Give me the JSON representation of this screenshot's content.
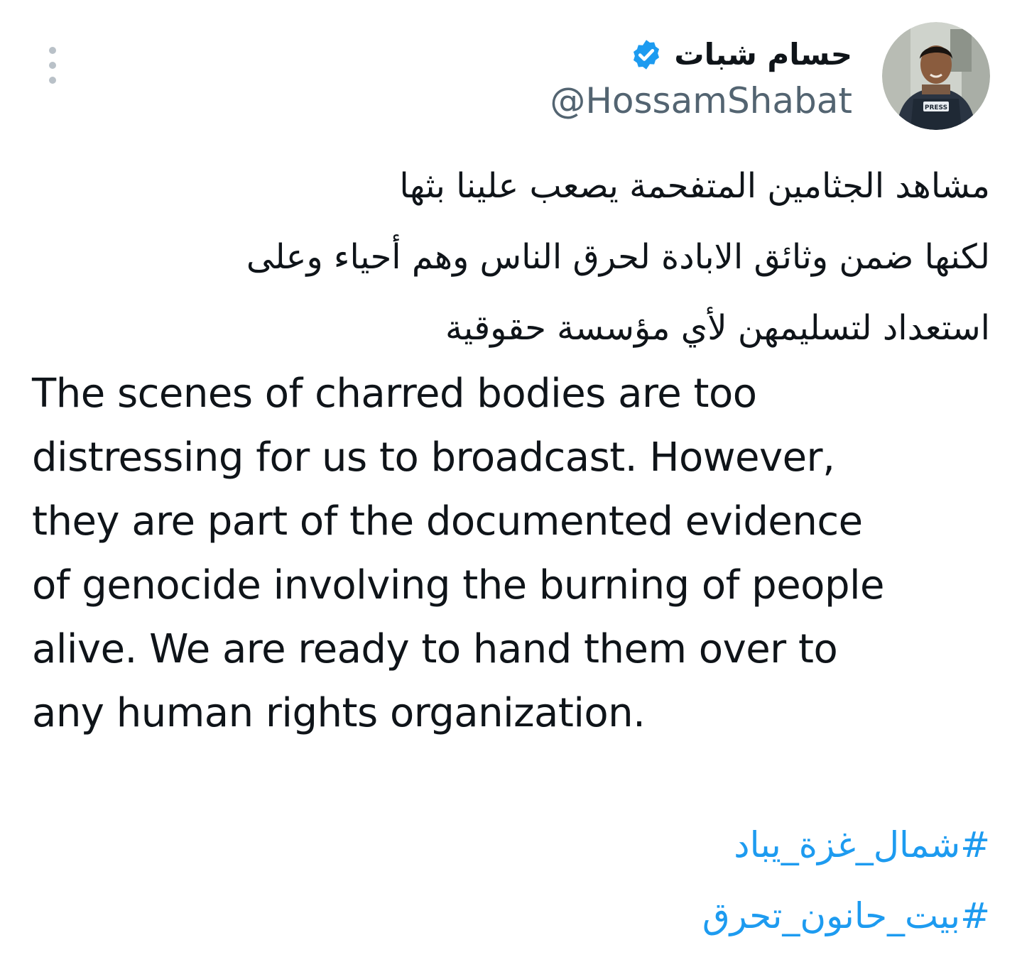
{
  "author": {
    "display_name": "حسام شبات",
    "handle": "@HossamShabat",
    "verified": true,
    "avatar_badge": "PRESS"
  },
  "tweet": {
    "arabic_lines": [
      "مشاهد الجثامين المتفحمة يصعب علينا بثها",
      "لكنها ضمن وثائق الابادة لحرق الناس وهم أحياء وعلى",
      "استعداد لتسليمهن لأي مؤسسة حقوقية"
    ],
    "english_lines": [
      "The scenes of charred bodies are too",
      "distressing for us to broadcast. However,",
      "they are part of the documented evidence",
      "of genocide involving the burning of people",
      "alive. We are ready to hand them over to",
      "any human rights organization."
    ],
    "hashtags": [
      "#شمال_غزة_يباد",
      "#بيت_حانون_تحرق"
    ]
  },
  "icons": {
    "more": "more-vertical-icon",
    "verified": "verified-badge-icon"
  },
  "colors": {
    "link": "#1d9bf0",
    "verified": "#1d9bf0",
    "secondary_text": "#536471",
    "primary_text": "#0f1419"
  }
}
